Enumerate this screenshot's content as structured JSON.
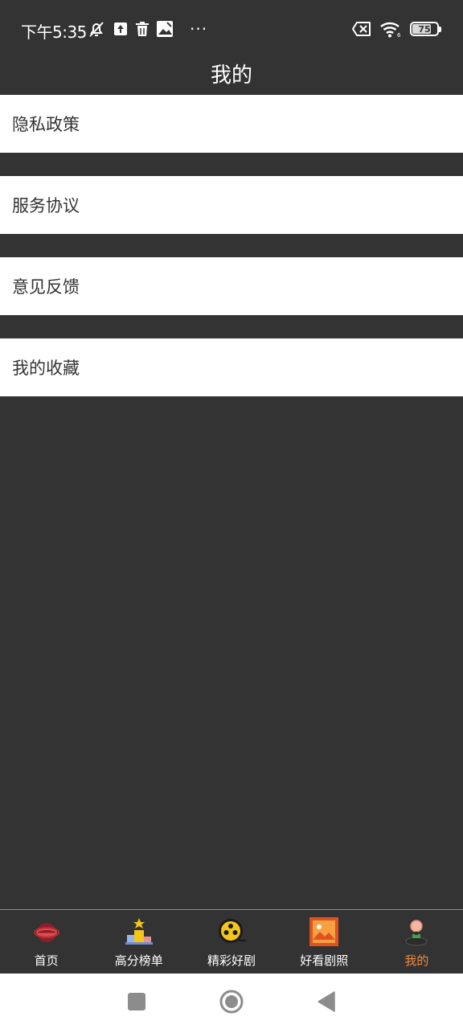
{
  "status_bar": {
    "time": "下午5:35",
    "more": "···",
    "battery_level": "75",
    "icons": [
      "mute-bell-icon",
      "upload-icon",
      "trash-icon",
      "image-icon",
      "sim-off-icon",
      "wifi-icon",
      "battery-icon"
    ]
  },
  "header": {
    "title": "我的"
  },
  "menu": {
    "items": [
      {
        "label": "隐私政策"
      },
      {
        "label": "服务协议"
      },
      {
        "label": "意见反馈"
      },
      {
        "label": "我的收藏"
      }
    ]
  },
  "tab_bar": {
    "tabs": [
      {
        "label": "首页",
        "icon": "home-globe-icon"
      },
      {
        "label": "高分榜单",
        "icon": "podium-icon"
      },
      {
        "label": "精彩好剧",
        "icon": "film-reel-icon"
      },
      {
        "label": "好看剧照",
        "icon": "picture-icon"
      },
      {
        "label": "我的",
        "icon": "profile-icon",
        "active": true
      }
    ],
    "active_color": "#f08a3c"
  },
  "nav_bar": {
    "buttons": [
      "recent-apps-icon",
      "home-icon",
      "back-icon"
    ]
  },
  "colors": {
    "background": "#333333",
    "card": "#ffffff",
    "accent": "#f08a3c"
  }
}
